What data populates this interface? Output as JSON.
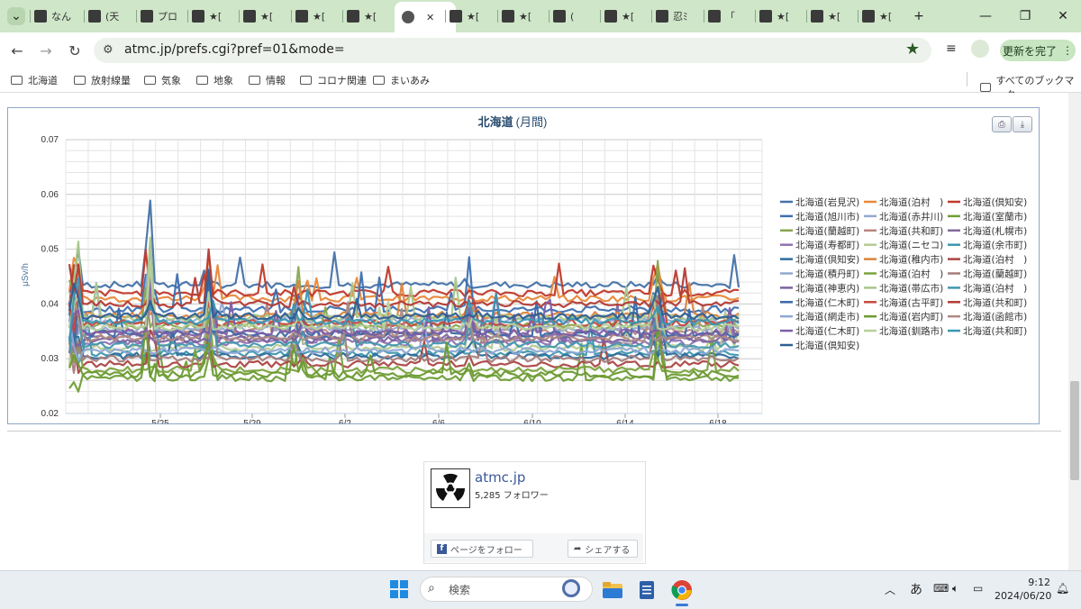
{
  "browser": {
    "tabs": [
      {
        "label": "なん",
        "x": 38,
        "w": 50
      },
      {
        "label": "(天",
        "x": 98,
        "w": 52
      },
      {
        "label": "プロ",
        "x": 156,
        "w": 50
      },
      {
        "label": "★[",
        "x": 213,
        "w": 50
      },
      {
        "label": "★[",
        "x": 270,
        "w": 50
      },
      {
        "label": "★[",
        "x": 328,
        "w": 50
      },
      {
        "label": "★[",
        "x": 385,
        "w": 50
      },
      {
        "label": "★[",
        "x": 499,
        "w": 50
      },
      {
        "label": "★[",
        "x": 557,
        "w": 50
      },
      {
        "label": "(",
        "x": 614,
        "w": 50
      },
      {
        "label": "★[",
        "x": 671,
        "w": 50
      },
      {
        "label": "忍ﾐ",
        "x": 728,
        "w": 50
      },
      {
        "label": "「",
        "x": 786,
        "w": 50
      },
      {
        "label": "★[",
        "x": 843,
        "w": 50
      },
      {
        "label": "★[",
        "x": 900,
        "w": 50
      },
      {
        "label": "★[",
        "x": 957,
        "w": 50
      }
    ],
    "new_tab": "+",
    "url": "atmc.jp/prefs.cgi?pref=01&mode=",
    "update_button": "更新を完了",
    "bookmarks": [
      "北海道",
      "放射線量",
      "気象",
      "地象",
      "情報",
      "コロナ関連",
      "まいあみ"
    ],
    "all_bookmarks": "すべてのブックマーク"
  },
  "chart_data": {
    "type": "line",
    "title": "北海道",
    "title_suffix": "(月間)",
    "ylabel": "μSv/h",
    "ylim": [
      0.02,
      0.07
    ],
    "yticks": [
      "0.07",
      "0.06",
      "0.05",
      "0.04",
      "0.03",
      "0.02"
    ],
    "xtick_labels": [
      "5/25",
      "5/29",
      "6/2",
      "6/6",
      "6/10",
      "6/14",
      "6/18"
    ],
    "grid": true,
    "legend_position": "right",
    "legend": [
      {
        "name": "北海道(岩見沢)",
        "color": "#4572a7"
      },
      {
        "name": "北海道(泊村　)",
        "color": "#e8883a"
      },
      {
        "name": "北海道(倶知安)",
        "color": "#c0392b"
      },
      {
        "name": "北海道(旭川市)",
        "color": "#3d6fb0"
      },
      {
        "name": "北海道(赤井川)",
        "color": "#93a9cf"
      },
      {
        "name": "北海道(室蘭市)",
        "color": "#6f9e37"
      },
      {
        "name": "北海道(蘭越町)",
        "color": "#89a54e"
      },
      {
        "name": "北海道(共和町)",
        "color": "#b9867e"
      },
      {
        "name": "北海道(札幌市)",
        "color": "#80699b"
      },
      {
        "name": "北海道(寿都町)",
        "color": "#8e72b0"
      },
      {
        "name": "北海道(ニセコ)",
        "color": "#b5ca92"
      },
      {
        "name": "北海道(余市町)",
        "color": "#3d96ae"
      },
      {
        "name": "北海道(倶知安)",
        "color": "#2f6b9a"
      },
      {
        "name": "北海道(稚内市)",
        "color": "#db843d"
      },
      {
        "name": "北海道(泊村　)",
        "color": "#aa4643"
      },
      {
        "name": "北海道(積丹町)",
        "color": "#92a8cd"
      },
      {
        "name": "北海道(泊村　)",
        "color": "#7aa33e"
      },
      {
        "name": "北海道(蘭越町)",
        "color": "#a47d7c"
      },
      {
        "name": "北海道(神恵内)",
        "color": "#7b62a0"
      },
      {
        "name": "北海道(帯広市)",
        "color": "#a8c78a"
      },
      {
        "name": "北海道(泊村　)",
        "color": "#4198af"
      },
      {
        "name": "北海道(仁木町)",
        "color": "#3a68a8"
      },
      {
        "name": "北海道(古平町)",
        "color": "#c44a3c"
      },
      {
        "name": "北海道(共和町)",
        "color": "#b33b34"
      },
      {
        "name": "北海道(網走市)",
        "color": "#8ea8d4"
      },
      {
        "name": "北海道(岩内町)",
        "color": "#6b9a31"
      },
      {
        "name": "北海道(函館市)",
        "color": "#b08a84"
      },
      {
        "name": "北海道(仁木町)",
        "color": "#7d5ea8"
      },
      {
        "name": "北海道(釧路市)",
        "color": "#b7d09a"
      },
      {
        "name": "北海道(共和町)",
        "color": "#3a97b3"
      },
      {
        "name": "北海道(倶知安)",
        "color": "#2e5f96"
      }
    ],
    "series_levels": [
      0.0435,
      0.041,
      0.042,
      0.039,
      0.037,
      0.0265,
      0.036,
      0.035,
      0.034,
      0.033,
      0.032,
      0.031,
      0.0305,
      0.038,
      0.029,
      0.0355,
      0.028,
      0.03,
      0.0335,
      0.0375,
      0.0325,
      0.0345,
      0.0365,
      0.04,
      0.0315,
      0.0272,
      0.0338,
      0.0348,
      0.0358,
      0.0368,
      0.0378
    ]
  },
  "facebook": {
    "name": "atmc.jp",
    "followers": "5,285 フォロワー",
    "follow_button": "ページをフォロー",
    "share_button": "シェアする"
  },
  "taskbar": {
    "search_placeholder": "検索",
    "ime": "あ",
    "time": "9:12",
    "date": "2024/06/20"
  }
}
